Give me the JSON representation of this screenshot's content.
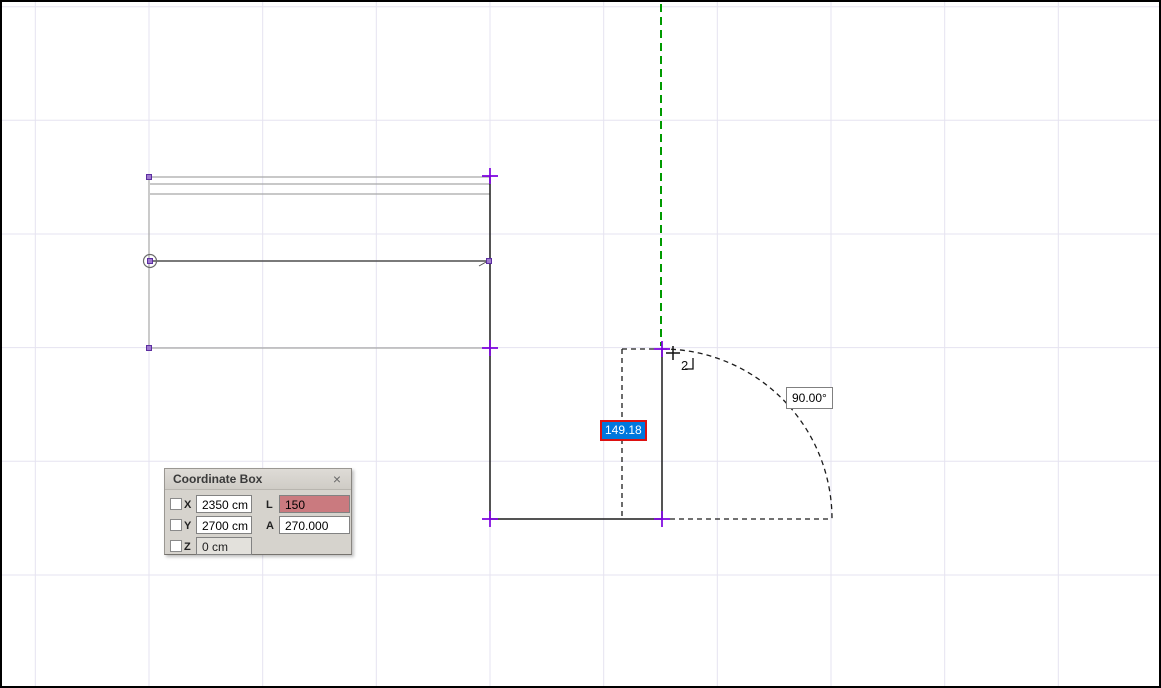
{
  "window": {
    "background": "#ffffff",
    "border_color": "#000000",
    "grid_color": "#e5e3f0"
  },
  "canvas": {
    "length_tag": {
      "text": "149.18",
      "bg_color": "#0077dd",
      "border_color": "#dd1111",
      "text_color": "#ffffff"
    },
    "angle_tag": {
      "text": "90.00°"
    },
    "cursor_hint": "2",
    "guide_line_color": "#009a00",
    "handle_color": "#7d00e0",
    "wall_line_color": "#a8a8a8",
    "sketch_line_color": "#1c1c1c"
  },
  "coordinate_box": {
    "title": "Coordinate Box",
    "close_label": "×",
    "x_label": "X",
    "x_value": "2350 cm",
    "y_label": "Y",
    "y_value": "2700 cm",
    "z_label": "Z",
    "z_value": "0 cm",
    "l_label": "L",
    "l_value": "150",
    "a_label": "A",
    "a_value": "270.000",
    "l_highlight_color": "#ca7a7f"
  }
}
